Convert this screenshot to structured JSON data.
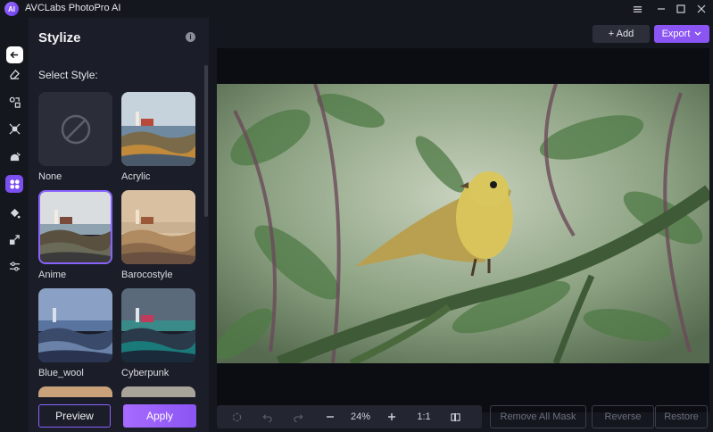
{
  "app": {
    "title": "AVCLabs PhotoPro AI",
    "logo_text": "AI"
  },
  "window_controls": [
    "settings-icon",
    "minimize-icon",
    "maximize-icon",
    "close-icon"
  ],
  "rail": {
    "items": [
      "eraser-icon",
      "object-icon",
      "enhance-icon",
      "face-icon",
      "stylize-icon",
      "colorize-icon",
      "upscale-icon",
      "adjust-icon"
    ],
    "active": "stylize-icon"
  },
  "panel": {
    "title": "Stylize",
    "select_label": "Select Style:",
    "styles": [
      {
        "label": "None"
      },
      {
        "label": "Acrylic"
      },
      {
        "label": "Anime"
      },
      {
        "label": "Barocostyle"
      },
      {
        "label": "Blue_wool"
      },
      {
        "label": "Cyberpunk"
      }
    ],
    "selected_style": "Anime",
    "preview_label": "Preview",
    "apply_label": "Apply"
  },
  "toolbar": {
    "add_label": "+ Add",
    "export_label": "Export"
  },
  "bottom": {
    "zoom": "24%",
    "ratio": "1:1",
    "remove_mask_label": "Remove All Mask",
    "reverse_label": "Reverse",
    "restore_label": "Restore"
  },
  "colors": {
    "accent": "#8b55f3",
    "panel_bg": "#1b1e28",
    "app_bg": "#15171f"
  }
}
